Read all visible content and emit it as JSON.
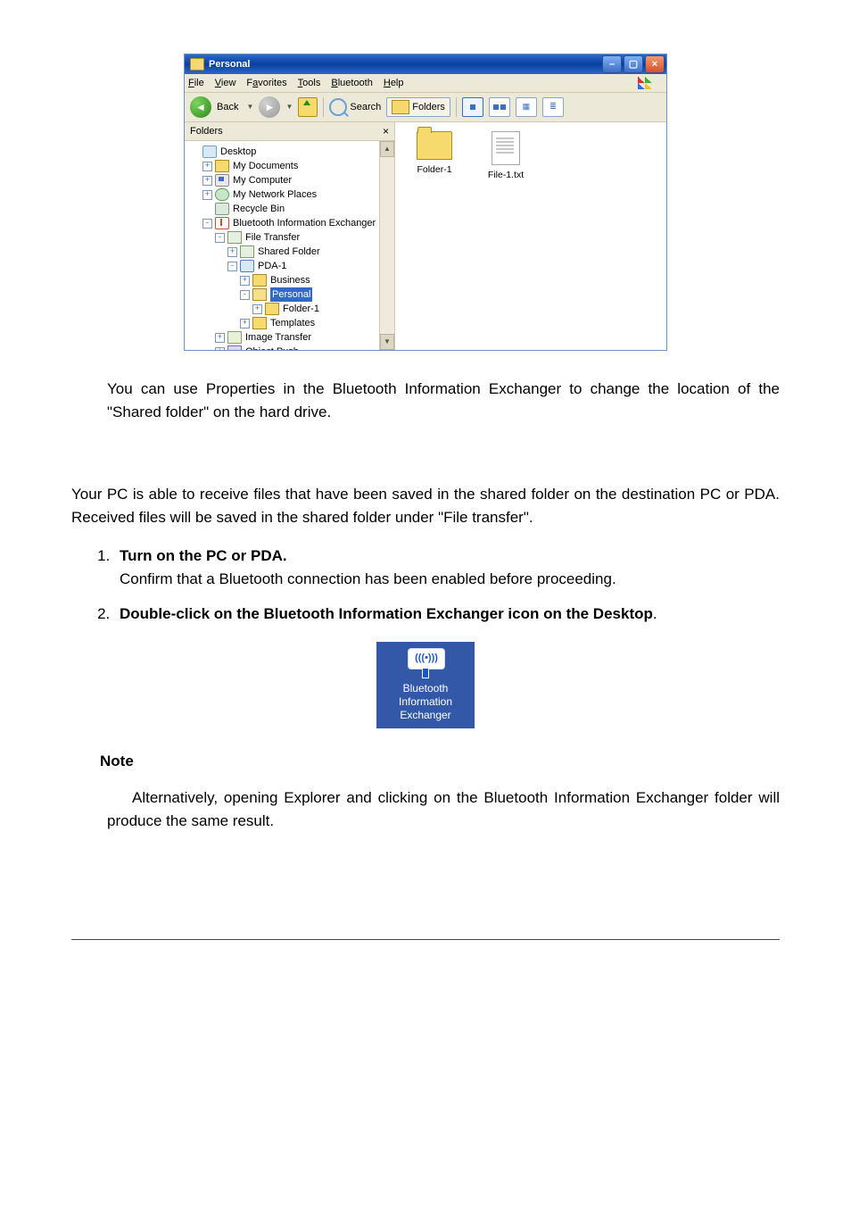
{
  "explorer": {
    "title": "Personal",
    "menu": {
      "file": "File",
      "view": "View",
      "favorites": "Favorites",
      "tools": "Tools",
      "bluetooth": "Bluetooth",
      "help": "Help"
    },
    "toolbar": {
      "back": "Back",
      "search": "Search",
      "folders": "Folders"
    },
    "tree_header": "Folders",
    "tree": {
      "desktop": "Desktop",
      "mydocs": "My Documents",
      "mycomp": "My Computer",
      "mynet": "My Network Places",
      "recycle": "Recycle Bin",
      "bt_exch": "Bluetooth Information Exchanger",
      "file_transfer": "File Transfer",
      "shared_folder": "Shared Folder",
      "pda1": "PDA-1",
      "business": "Business",
      "personal": "Personal",
      "folder1": "Folder-1",
      "templates": "Templates",
      "image_transfer": "Image Transfer",
      "object_push": "Object Push"
    },
    "content": {
      "folder1": "Folder-1",
      "file1": "File-1.txt"
    }
  },
  "doc": {
    "p1": "You can use Properties in the Bluetooth Information Exchanger to change the location of the \"Shared folder\" on the hard drive.",
    "p2": "Your PC is able to receive files that have been saved in the shared folder on the destination PC or PDA. Received files will be saved in the shared folder under \"File transfer\".",
    "step1_title": "Turn on the PC or PDA.",
    "step1_body": "Confirm that a Bluetooth connection has been enabled before proceeding.",
    "step2_title": "Double-click on the Bluetooth Information Exchanger icon on the Desktop",
    "step2_tail": ".",
    "bt_icon": {
      "l1": "Bluetooth",
      "l2": "Information",
      "l3": "Exchanger"
    },
    "note_head": "Note",
    "note_body": "Alternatively, opening Explorer and clicking on the Bluetooth Information Exchanger folder will produce the same result."
  }
}
